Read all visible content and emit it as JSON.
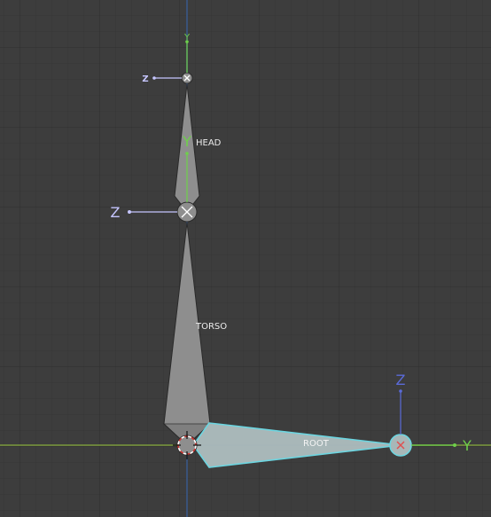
{
  "viewport": {
    "bones": [
      {
        "name": "HEAD"
      },
      {
        "name": "TORSO"
      },
      {
        "name": "ROOT"
      }
    ],
    "gizmos": {
      "head_tip": {
        "y": "Y",
        "z": "Z"
      },
      "head_base": {
        "y": "Y",
        "z": "Z"
      },
      "root_tip": {
        "z": "Z",
        "y": "Y"
      }
    }
  },
  "colors": {
    "background": "#3d3d3d",
    "grid_minor": "#363636",
    "grid_major": "#303030",
    "x_axis": "#7b9a3c",
    "z_axis": "#3a5a8c",
    "bone_fill": "#8e8e8e",
    "bone_outline": "#2a2a2a",
    "selected_bone": "#6cd5e0",
    "axis_y": "#6ed04a",
    "axis_z_label": "#c6c6ff"
  }
}
